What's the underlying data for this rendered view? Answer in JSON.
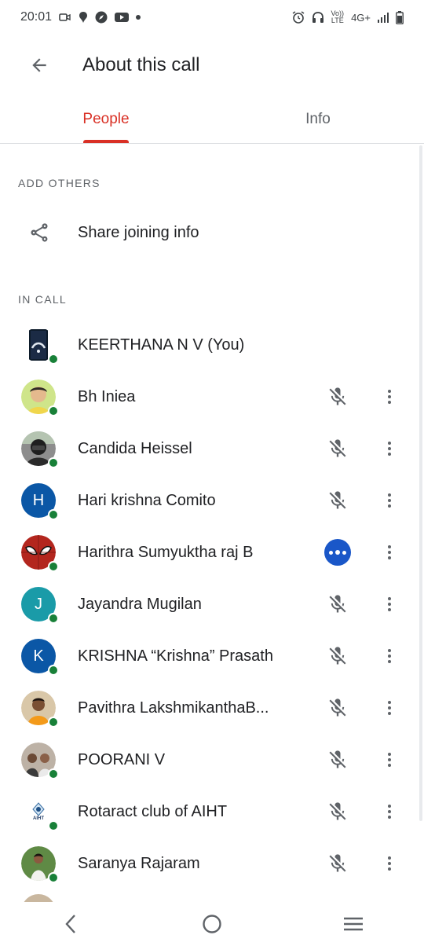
{
  "status_bar": {
    "time": "20:01",
    "left_icons": [
      "camera-icon",
      "chat-icon",
      "compass-icon",
      "youtube-icon",
      "dot-icon"
    ],
    "right_icons": [
      "alarm-icon",
      "headphones-icon",
      "volte-icon",
      "network-4g-icon",
      "signal-icon",
      "battery-icon"
    ],
    "volte_top": "Vo))",
    "volte_bottom": "LTE",
    "network": "4G+"
  },
  "app_bar": {
    "title": "About this call",
    "back_icon": "arrow-back-icon"
  },
  "tabs": [
    {
      "label": "People",
      "active": true
    },
    {
      "label": "Info",
      "active": false
    }
  ],
  "add_others": {
    "header": "ADD OTHERS",
    "share_label": "Share joining info",
    "share_icon": "share-icon"
  },
  "in_call": {
    "header": "IN CALL",
    "people": [
      {
        "name": "KEERTHANA N V (You)",
        "avatar": "photo-dark",
        "mic": "none"
      },
      {
        "name": "Bh Iniea",
        "avatar": "photo-yellow",
        "mic": "muted"
      },
      {
        "name": "Candida Heissel",
        "avatar": "photo-rider",
        "mic": "muted"
      },
      {
        "name": "Hari krishna Comito",
        "avatar": "letter",
        "letter": "H",
        "color": "#0b57a6",
        "mic": "muted"
      },
      {
        "name": "Harithra Sumyuktha raj B",
        "avatar": "spiderman",
        "mic": "speaking"
      },
      {
        "name": "Jayandra Mugilan",
        "avatar": "letter",
        "letter": "J",
        "color": "#1a9ba8",
        "mic": "muted"
      },
      {
        "name": "KRISHNA “Krishna” Prasath",
        "avatar": "letter",
        "letter": "K",
        "color": "#0b57a6",
        "mic": "muted"
      },
      {
        "name": "Pavithra LakshmikanthaB...",
        "avatar": "photo-orange",
        "mic": "muted"
      },
      {
        "name": "POORANI V",
        "avatar": "photo-group",
        "mic": "muted"
      },
      {
        "name": "Rotaract club of AIHT",
        "avatar": "logo-aiht",
        "logo_text": "AIHT",
        "mic": "muted"
      },
      {
        "name": "Saranya Rajaram",
        "avatar": "photo-green",
        "mic": "muted"
      }
    ]
  },
  "nav_bar": {
    "icons": [
      "nav-back-icon",
      "nav-home-icon",
      "nav-recents-icon"
    ]
  },
  "colors": {
    "accent": "#d93025",
    "online": "#188038",
    "speaking": "#1a57c8"
  }
}
